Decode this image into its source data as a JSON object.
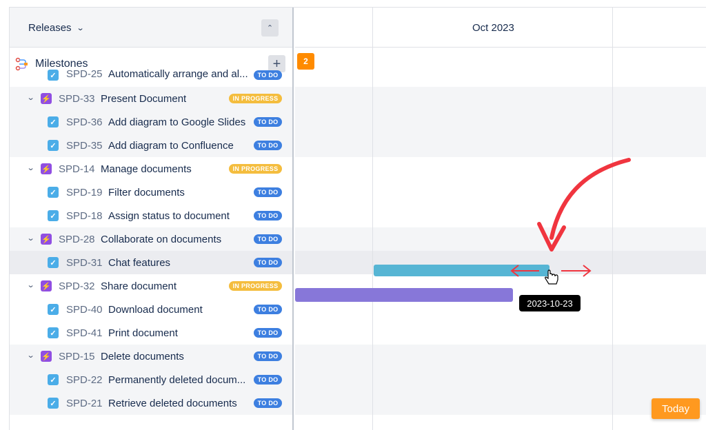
{
  "left": {
    "releases_label": "Releases",
    "milestones_label": "Milestones"
  },
  "rows": [
    {
      "kind": "task",
      "key": "SPD-25",
      "title": "Automatically arrange and al...",
      "status": "TO DO",
      "status_type": "todo",
      "shade": false
    },
    {
      "kind": "epic",
      "key": "SPD-33",
      "title": "Present Document",
      "status": "IN PROGRESS",
      "status_type": "prog",
      "shade": true
    },
    {
      "kind": "task",
      "key": "SPD-36",
      "title": "Add diagram to Google Slides",
      "status": "TO DO",
      "status_type": "todo",
      "shade": true
    },
    {
      "kind": "task",
      "key": "SPD-35",
      "title": "Add diagram to Confluence",
      "status": "TO DO",
      "status_type": "todo",
      "shade": true
    },
    {
      "kind": "epic",
      "key": "SPD-14",
      "title": "Manage documents",
      "status": "IN PROGRESS",
      "status_type": "prog",
      "shade": false
    },
    {
      "kind": "task",
      "key": "SPD-19",
      "title": "Filter documents",
      "status": "TO DO",
      "status_type": "todo",
      "shade": false
    },
    {
      "kind": "task",
      "key": "SPD-18",
      "title": "Assign status to document",
      "status": "TO DO",
      "status_type": "todo",
      "shade": false
    },
    {
      "kind": "epic",
      "key": "SPD-28",
      "title": "Collaborate on documents",
      "status": "TO DO",
      "status_type": "todo",
      "shade": true
    },
    {
      "kind": "task",
      "key": "SPD-31",
      "title": "Chat features",
      "status": "TO DO",
      "status_type": "todo",
      "shade": "highlight"
    },
    {
      "kind": "epic",
      "key": "SPD-32",
      "title": "Share document",
      "status": "IN PROGRESS",
      "status_type": "prog",
      "shade": false
    },
    {
      "kind": "task",
      "key": "SPD-40",
      "title": "Download document",
      "status": "TO DO",
      "status_type": "todo",
      "shade": false
    },
    {
      "kind": "task",
      "key": "SPD-41",
      "title": "Print document",
      "status": "TO DO",
      "status_type": "todo",
      "shade": false
    },
    {
      "kind": "epic",
      "key": "SPD-15",
      "title": "Delete documents",
      "status": "TO DO",
      "status_type": "todo",
      "shade": true
    },
    {
      "kind": "task",
      "key": "SPD-22",
      "title": "Permanently deleted docum...",
      "status": "TO DO",
      "status_type": "todo",
      "shade": true
    },
    {
      "kind": "task",
      "key": "SPD-21",
      "title": "Retrieve deleted documents",
      "status": "TO DO",
      "status_type": "todo",
      "shade": true
    }
  ],
  "timeline": {
    "month_label": "Oct 2023",
    "milestone_count": "2",
    "drag_tooltip": "2023-10-23",
    "today_label": "Today"
  },
  "colors": {
    "accent_orange": "#ff991f",
    "bar_blue": "#56b5d4",
    "bar_purple": "#8777d9",
    "epic_purple": "#904ee2",
    "annotation_red": "#f0353f"
  },
  "icons": {
    "releases_chevron": "chevron-down-icon",
    "collapse": "collapse-up-icon",
    "milestones": "milestones-icon",
    "add": "plus-icon",
    "epic": "lightning-icon",
    "task": "checkbox-icon",
    "cursor": "hand-pointer-icon"
  }
}
